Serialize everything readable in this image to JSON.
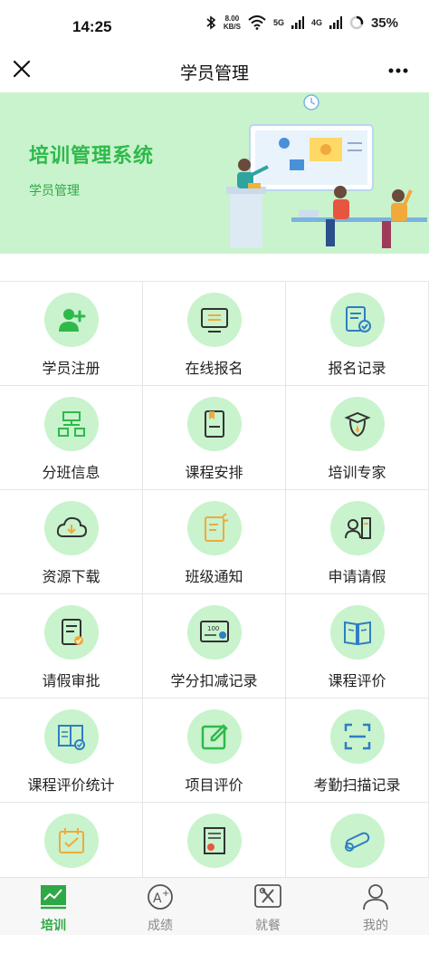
{
  "status": {
    "time": "14:25",
    "speed_value": "8.00",
    "speed_unit": "KB/S",
    "net1": "5G",
    "net2": "4G",
    "battery": "35%"
  },
  "nav": {
    "title": "学员管理"
  },
  "banner": {
    "title": "培训管理系统",
    "subtitle": "学员管理"
  },
  "menu": [
    {
      "label": "学员注册",
      "icon": "user-add-icon"
    },
    {
      "label": "在线报名",
      "icon": "monitor-icon"
    },
    {
      "label": "报名记录",
      "icon": "record-check-icon"
    },
    {
      "label": "分班信息",
      "icon": "org-chart-icon"
    },
    {
      "label": "课程安排",
      "icon": "book-schedule-icon"
    },
    {
      "label": "培训专家",
      "icon": "expert-icon"
    },
    {
      "label": "资源下载",
      "icon": "cloud-download-icon"
    },
    {
      "label": "班级通知",
      "icon": "notice-icon"
    },
    {
      "label": "申请请假",
      "icon": "id-card-icon"
    },
    {
      "label": "请假审批",
      "icon": "approval-icon"
    },
    {
      "label": "学分扣减记录",
      "icon": "score-board-icon"
    },
    {
      "label": "课程评价",
      "icon": "open-book-icon"
    },
    {
      "label": "课程评价统计",
      "icon": "stats-doc-icon"
    },
    {
      "label": "项目评价",
      "icon": "edit-icon"
    },
    {
      "label": "考勤扫描记录",
      "icon": "scan-icon"
    },
    {
      "label": "",
      "icon": "calendar-check-icon"
    },
    {
      "label": "",
      "icon": "certificate-icon"
    },
    {
      "label": "",
      "icon": "diploma-scroll-icon"
    }
  ],
  "tabs": [
    {
      "label": "培训",
      "icon": "chart-board-icon",
      "active": true
    },
    {
      "label": "成绩",
      "icon": "grade-a-plus-icon",
      "active": false
    },
    {
      "label": "就餐",
      "icon": "dining-icon",
      "active": false
    },
    {
      "label": "我的",
      "icon": "person-icon",
      "active": false
    }
  ],
  "colors": {
    "accent_green": "#2fb94b",
    "icon_blue": "#2f7dc4",
    "icon_orange": "#f2a93b",
    "banner_bg": "#c9f3cc"
  }
}
